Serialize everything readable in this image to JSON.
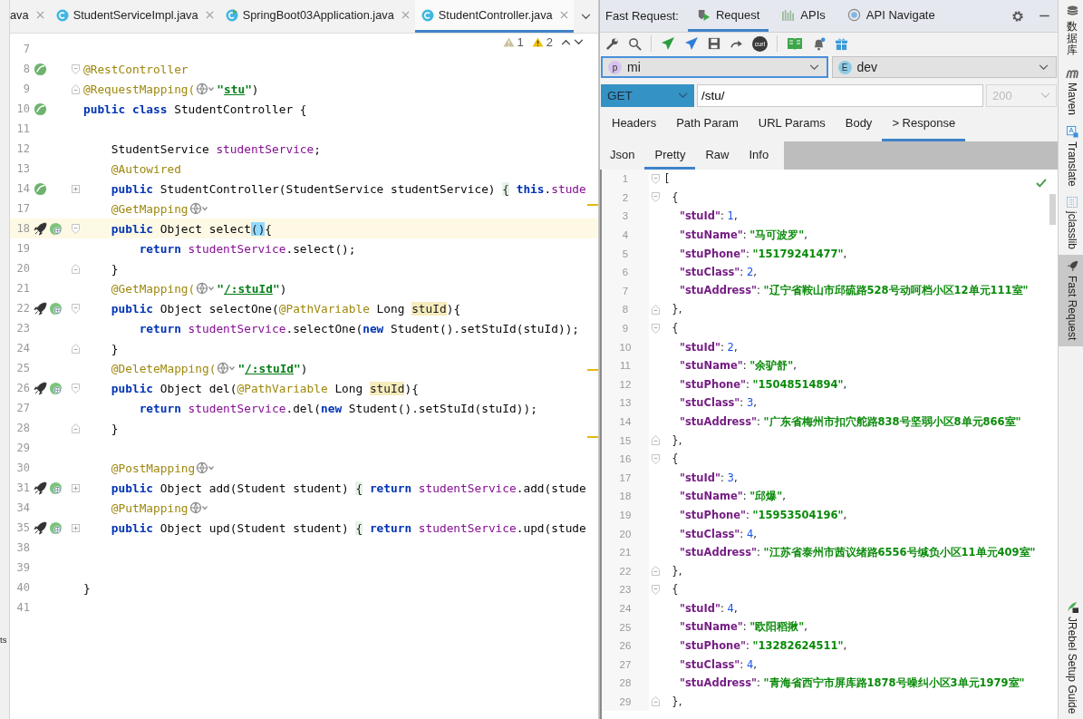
{
  "editor": {
    "tabs": [
      {
        "label": "ava",
        "selected": false,
        "kind": "plain"
      },
      {
        "label": "StudentServiceImpl.java",
        "selected": false,
        "kind": "class"
      },
      {
        "label": "SpringBoot03Application.java",
        "selected": false,
        "kind": "app"
      },
      {
        "label": "StudentController.java",
        "selected": true,
        "kind": "class"
      }
    ],
    "inspection": {
      "weak_warnings": "1",
      "warnings": "2"
    },
    "lines": [
      {
        "num": "7"
      },
      {
        "num": "8",
        "gutter": [
          {
            "kind": "bean"
          }
        ],
        "fold": {
          "kind": "open"
        },
        "tokens": [
          {
            "text": "@RestController",
            "kind": "ann"
          }
        ]
      },
      {
        "num": "9",
        "fold": {
          "kind": "close"
        },
        "tokens": [
          {
            "text": "@RequestMapping(",
            "kind": "ann"
          },
          {
            "kind": "globe"
          },
          {
            "text": "\"",
            "kind": "str"
          },
          {
            "text": "stu",
            "kind": "url"
          },
          {
            "text": "\"",
            "kind": "str"
          },
          {
            "text": ")",
            "kind": "plain"
          }
        ]
      },
      {
        "num": "10",
        "gutter": [
          {
            "kind": "bean"
          }
        ],
        "tokens": [
          {
            "text": "public class ",
            "kind": "kw"
          },
          {
            "text": "StudentController {",
            "kind": "plain"
          }
        ]
      },
      {
        "num": "11"
      },
      {
        "num": "12",
        "tokens": [
          {
            "text": "    StudentService ",
            "kind": "plain"
          },
          {
            "text": "studentService",
            "kind": "field"
          },
          {
            "text": ";",
            "kind": "plain"
          }
        ]
      },
      {
        "num": "13",
        "tokens": [
          {
            "text": "    @Autowired",
            "kind": "ann"
          }
        ]
      },
      {
        "num": "14",
        "gutter": [
          {
            "kind": "bean"
          }
        ],
        "fold": {
          "kind": "plus"
        },
        "tokens": [
          {
            "text": "    public ",
            "kind": "kw"
          },
          {
            "text": "StudentController(StudentService studentService) ",
            "kind": "plain"
          },
          {
            "text": "{",
            "kind": "fold"
          },
          {
            "text": " this",
            "kind": "kw"
          },
          {
            "text": ".",
            "kind": "plain"
          },
          {
            "text": "stude",
            "kind": "field"
          }
        ]
      },
      {
        "num": "17",
        "tokens": [
          {
            "text": "    @GetMapping",
            "kind": "ann"
          },
          {
            "kind": "globe"
          }
        ]
      },
      {
        "num": "18",
        "highlighted": true,
        "gutter": [
          {
            "kind": "rocket"
          },
          {
            "kind": "globe"
          }
        ],
        "fold": {
          "kind": "open"
        },
        "tokens": [
          {
            "text": "    public ",
            "kind": "kw"
          },
          {
            "text": "Object select",
            "kind": "plain"
          },
          {
            "text": "()",
            "kind": "match"
          },
          {
            "text": "{",
            "kind": "plain"
          }
        ]
      },
      {
        "num": "19",
        "tokens": [
          {
            "text": "        return ",
            "kind": "kw"
          },
          {
            "text": "studentService",
            "kind": "field"
          },
          {
            "text": ".select();",
            "kind": "plain"
          }
        ]
      },
      {
        "num": "20",
        "fold": {
          "kind": "close"
        },
        "tokens": [
          {
            "text": "    }",
            "kind": "plain"
          }
        ]
      },
      {
        "num": "21",
        "tokens": [
          {
            "text": "    @GetMapping(",
            "kind": "ann"
          },
          {
            "kind": "globe"
          },
          {
            "text": "\"",
            "kind": "str"
          },
          {
            "text": "/:stuId",
            "kind": "url"
          },
          {
            "text": "\"",
            "kind": "str"
          },
          {
            "text": ")",
            "kind": "plain"
          }
        ]
      },
      {
        "num": "22",
        "gutter": [
          {
            "kind": "rocket"
          },
          {
            "kind": "globe"
          }
        ],
        "fold": {
          "kind": "open"
        },
        "tokens": [
          {
            "text": "    public ",
            "kind": "kw"
          },
          {
            "text": "Object selectOne(",
            "kind": "plain"
          },
          {
            "text": "@PathVariable",
            "kind": "ann"
          },
          {
            "text": " Long ",
            "kind": "plain"
          },
          {
            "text": "stuId",
            "kind": "hl"
          },
          {
            "text": "){",
            "kind": "plain"
          }
        ]
      },
      {
        "num": "23",
        "tokens": [
          {
            "text": "        return ",
            "kind": "kw"
          },
          {
            "text": "studentService",
            "kind": "field"
          },
          {
            "text": ".selectOne(",
            "kind": "plain"
          },
          {
            "text": "new",
            "kind": "kw"
          },
          {
            "text": " Student().setStuId(stuId));",
            "kind": "plain"
          }
        ]
      },
      {
        "num": "24",
        "fold": {
          "kind": "close"
        },
        "tokens": [
          {
            "text": "    }",
            "kind": "plain"
          }
        ]
      },
      {
        "num": "25",
        "tokens": [
          {
            "text": "    @DeleteMapping(",
            "kind": "ann"
          },
          {
            "kind": "globe"
          },
          {
            "text": "\"",
            "kind": "str"
          },
          {
            "text": "/:stuId",
            "kind": "url"
          },
          {
            "text": "\"",
            "kind": "str"
          },
          {
            "text": ")",
            "kind": "plain"
          }
        ]
      },
      {
        "num": "26",
        "gutter": [
          {
            "kind": "rocket"
          },
          {
            "kind": "globe"
          }
        ],
        "fold": {
          "kind": "open"
        },
        "tokens": [
          {
            "text": "    public ",
            "kind": "kw"
          },
          {
            "text": "Object del(",
            "kind": "plain"
          },
          {
            "text": "@PathVariable",
            "kind": "ann"
          },
          {
            "text": " Long ",
            "kind": "plain"
          },
          {
            "text": "stuId",
            "kind": "hl"
          },
          {
            "text": "){",
            "kind": "plain"
          }
        ]
      },
      {
        "num": "27",
        "tokens": [
          {
            "text": "        return ",
            "kind": "kw"
          },
          {
            "text": "studentService",
            "kind": "field"
          },
          {
            "text": ".del(",
            "kind": "plain"
          },
          {
            "text": "new",
            "kind": "kw"
          },
          {
            "text": " Student().setStuId(stuId));",
            "kind": "plain"
          }
        ]
      },
      {
        "num": "28",
        "fold": {
          "kind": "close"
        },
        "tokens": [
          {
            "text": "    }",
            "kind": "plain"
          }
        ]
      },
      {
        "num": "29"
      },
      {
        "num": "30",
        "tokens": [
          {
            "text": "    @PostMapping",
            "kind": "ann"
          },
          {
            "kind": "globe"
          }
        ]
      },
      {
        "num": "31",
        "gutter": [
          {
            "kind": "rocket"
          },
          {
            "kind": "globe"
          }
        ],
        "fold": {
          "kind": "plus"
        },
        "tokens": [
          {
            "text": "    public ",
            "kind": "kw"
          },
          {
            "text": "Object add(Student student) ",
            "kind": "plain"
          },
          {
            "text": "{",
            "kind": "fold"
          },
          {
            "text": " return ",
            "kind": "kw"
          },
          {
            "text": "studentService",
            "kind": "field"
          },
          {
            "text": ".add(stude",
            "kind": "plain"
          }
        ]
      },
      {
        "num": "34",
        "tokens": [
          {
            "text": "    @PutMapping",
            "kind": "ann"
          },
          {
            "kind": "globe"
          }
        ]
      },
      {
        "num": "35",
        "gutter": [
          {
            "kind": "rocket"
          },
          {
            "kind": "globe"
          }
        ],
        "fold": {
          "kind": "plus"
        },
        "tokens": [
          {
            "text": "    public ",
            "kind": "kw"
          },
          {
            "text": "Object upd(Student student) ",
            "kind": "plain"
          },
          {
            "text": "{",
            "kind": "fold"
          },
          {
            "text": " return ",
            "kind": "kw"
          },
          {
            "text": "studentService",
            "kind": "field"
          },
          {
            "text": ".upd(stude",
            "kind": "plain"
          }
        ]
      },
      {
        "num": "38"
      },
      {
        "num": "39"
      },
      {
        "num": "40",
        "tokens": [
          {
            "text": "}",
            "kind": "plain"
          }
        ]
      },
      {
        "num": "41"
      }
    ],
    "left_strip": {
      "text": "ts"
    }
  },
  "fast_request": {
    "title": "Fast Request:",
    "tabs": [
      {
        "label": "Request",
        "selected": true,
        "kind": "request"
      },
      {
        "label": "APIs",
        "selected": false,
        "kind": "apis"
      },
      {
        "label": "API Navigate",
        "selected": false,
        "kind": "navigate"
      }
    ],
    "curl_label": "curl",
    "project": {
      "badge": "p",
      "value": "mi",
      "focused": true
    },
    "environment": {
      "badge": "E",
      "value": "dev",
      "focused": false
    },
    "method": "GET",
    "url": "/stu/",
    "status": {
      "value": "200",
      "disabled": true
    },
    "request_tabs": [
      {
        "label": "Headers",
        "selected": false
      },
      {
        "label": "Path Param",
        "selected": false
      },
      {
        "label": "URL Params",
        "selected": false
      },
      {
        "label": "Body",
        "selected": false
      },
      {
        "label": "> Response",
        "selected": true
      }
    ],
    "response_tabs": [
      {
        "label": "Json",
        "selected": false
      },
      {
        "label": "Pretty",
        "selected": true
      },
      {
        "label": "Raw",
        "selected": false
      },
      {
        "label": "Info",
        "selected": false
      }
    ],
    "response_lines": [
      {
        "num": "1",
        "fold": {
          "kind": "open"
        },
        "tokens": [
          {
            "text": "[",
            "kind": "punct"
          }
        ]
      },
      {
        "num": "2",
        "fold": {
          "kind": "open"
        },
        "tokens": [
          {
            "text": "  {",
            "kind": "punct"
          }
        ]
      },
      {
        "num": "3",
        "tokens": [
          {
            "text": "    \"stuId\"",
            "kind": "key"
          },
          {
            "text": ": ",
            "kind": "punct"
          },
          {
            "text": "1",
            "kind": "num"
          },
          {
            "text": ",",
            "kind": "punct"
          }
        ]
      },
      {
        "num": "4",
        "tokens": [
          {
            "text": "    \"stuName\"",
            "kind": "key"
          },
          {
            "text": ": ",
            "kind": "punct"
          },
          {
            "text": "\"马可波罗\"",
            "kind": "str"
          },
          {
            "text": ",",
            "kind": "punct"
          }
        ]
      },
      {
        "num": "5",
        "tokens": [
          {
            "text": "    \"stuPhone\"",
            "kind": "key"
          },
          {
            "text": ": ",
            "kind": "punct"
          },
          {
            "text": "\"15179241477\"",
            "kind": "str"
          },
          {
            "text": ",",
            "kind": "punct"
          }
        ]
      },
      {
        "num": "6",
        "tokens": [
          {
            "text": "    \"stuClass\"",
            "kind": "key"
          },
          {
            "text": ": ",
            "kind": "punct"
          },
          {
            "text": "2",
            "kind": "num"
          },
          {
            "text": ",",
            "kind": "punct"
          }
        ]
      },
      {
        "num": "7",
        "tokens": [
          {
            "text": "    \"stuAddress\"",
            "kind": "key"
          },
          {
            "text": ": ",
            "kind": "punct"
          },
          {
            "text": "\"辽宁省鞍山市邱硫路528号动呵档小区12单元111室\"",
            "kind": "str"
          }
        ]
      },
      {
        "num": "8",
        "fold": {
          "kind": "close"
        },
        "tokens": [
          {
            "text": "  },",
            "kind": "punct"
          }
        ]
      },
      {
        "num": "9",
        "fold": {
          "kind": "open"
        },
        "tokens": [
          {
            "text": "  {",
            "kind": "punct"
          }
        ]
      },
      {
        "num": "10",
        "tokens": [
          {
            "text": "    \"stuId\"",
            "kind": "key"
          },
          {
            "text": ": ",
            "kind": "punct"
          },
          {
            "text": "2",
            "kind": "num"
          },
          {
            "text": ",",
            "kind": "punct"
          }
        ]
      },
      {
        "num": "11",
        "tokens": [
          {
            "text": "    \"stuName\"",
            "kind": "key"
          },
          {
            "text": ": ",
            "kind": "punct"
          },
          {
            "text": "\"余驴舒\"",
            "kind": "str"
          },
          {
            "text": ",",
            "kind": "punct"
          }
        ]
      },
      {
        "num": "12",
        "tokens": [
          {
            "text": "    \"stuPhone\"",
            "kind": "key"
          },
          {
            "text": ": ",
            "kind": "punct"
          },
          {
            "text": "\"15048514894\"",
            "kind": "str"
          },
          {
            "text": ",",
            "kind": "punct"
          }
        ]
      },
      {
        "num": "13",
        "tokens": [
          {
            "text": "    \"stuClass\"",
            "kind": "key"
          },
          {
            "text": ": ",
            "kind": "punct"
          },
          {
            "text": "3",
            "kind": "num"
          },
          {
            "text": ",",
            "kind": "punct"
          }
        ]
      },
      {
        "num": "14",
        "tokens": [
          {
            "text": "    \"stuAddress\"",
            "kind": "key"
          },
          {
            "text": ": ",
            "kind": "punct"
          },
          {
            "text": "\"广东省梅州市扣穴舵路838号坚弱小区8单元866室\"",
            "kind": "str"
          }
        ]
      },
      {
        "num": "15",
        "fold": {
          "kind": "close"
        },
        "tokens": [
          {
            "text": "  },",
            "kind": "punct"
          }
        ]
      },
      {
        "num": "16",
        "fold": {
          "kind": "open"
        },
        "tokens": [
          {
            "text": "  {",
            "kind": "punct"
          }
        ]
      },
      {
        "num": "17",
        "tokens": [
          {
            "text": "    \"stuId\"",
            "kind": "key"
          },
          {
            "text": ": ",
            "kind": "punct"
          },
          {
            "text": "3",
            "kind": "num"
          },
          {
            "text": ",",
            "kind": "punct"
          }
        ]
      },
      {
        "num": "18",
        "tokens": [
          {
            "text": "    \"stuName\"",
            "kind": "key"
          },
          {
            "text": ": ",
            "kind": "punct"
          },
          {
            "text": "\"邱爆\"",
            "kind": "str"
          },
          {
            "text": ",",
            "kind": "punct"
          }
        ]
      },
      {
        "num": "19",
        "tokens": [
          {
            "text": "    \"stuPhone\"",
            "kind": "key"
          },
          {
            "text": ": ",
            "kind": "punct"
          },
          {
            "text": "\"15953504196\"",
            "kind": "str"
          },
          {
            "text": ",",
            "kind": "punct"
          }
        ]
      },
      {
        "num": "20",
        "tokens": [
          {
            "text": "    \"stuClass\"",
            "kind": "key"
          },
          {
            "text": ": ",
            "kind": "punct"
          },
          {
            "text": "4",
            "kind": "num"
          },
          {
            "text": ",",
            "kind": "punct"
          }
        ]
      },
      {
        "num": "21",
        "tokens": [
          {
            "text": "    \"stuAddress\"",
            "kind": "key"
          },
          {
            "text": ": ",
            "kind": "punct"
          },
          {
            "text": "\"江苏省泰州市茜议绪路6556号缄负小区11单元409室\"",
            "kind": "str"
          }
        ]
      },
      {
        "num": "22",
        "fold": {
          "kind": "close"
        },
        "tokens": [
          {
            "text": "  },",
            "kind": "punct"
          }
        ]
      },
      {
        "num": "23",
        "fold": {
          "kind": "open"
        },
        "tokens": [
          {
            "text": "  {",
            "kind": "punct"
          }
        ]
      },
      {
        "num": "24",
        "tokens": [
          {
            "text": "    \"stuId\"",
            "kind": "key"
          },
          {
            "text": ": ",
            "kind": "punct"
          },
          {
            "text": "4",
            "kind": "num"
          },
          {
            "text": ",",
            "kind": "punct"
          }
        ]
      },
      {
        "num": "25",
        "tokens": [
          {
            "text": "    \"stuName\"",
            "kind": "key"
          },
          {
            "text": ": ",
            "kind": "punct"
          },
          {
            "text": "\"欧阳稻揪\"",
            "kind": "str"
          },
          {
            "text": ",",
            "kind": "punct"
          }
        ]
      },
      {
        "num": "26",
        "tokens": [
          {
            "text": "    \"stuPhone\"",
            "kind": "key"
          },
          {
            "text": ": ",
            "kind": "punct"
          },
          {
            "text": "\"13282624511\"",
            "kind": "str"
          },
          {
            "text": ",",
            "kind": "punct"
          }
        ]
      },
      {
        "num": "27",
        "tokens": [
          {
            "text": "    \"stuClass\"",
            "kind": "key"
          },
          {
            "text": ": ",
            "kind": "punct"
          },
          {
            "text": "4",
            "kind": "num"
          },
          {
            "text": ",",
            "kind": "punct"
          }
        ]
      },
      {
        "num": "28",
        "tokens": [
          {
            "text": "    \"stuAddress\"",
            "kind": "key"
          },
          {
            "text": ": ",
            "kind": "punct"
          },
          {
            "text": "\"青海省西宁市屏库路1878号噪纠小区3单元1979室\"",
            "kind": "str"
          }
        ]
      },
      {
        "num": "29",
        "fold": {
          "kind": "close"
        },
        "tokens": [
          {
            "text": "  },",
            "kind": "punct"
          }
        ]
      }
    ]
  },
  "tool_windows": {
    "top": [
      {
        "label": "数据库",
        "kind": "database",
        "stacked": true,
        "selected": false
      },
      {
        "label": "Maven",
        "kind": "maven",
        "stacked": false,
        "selected": false
      },
      {
        "label": "Translate",
        "kind": "translate",
        "stacked": false,
        "selected": false
      },
      {
        "label": "jclasslib",
        "kind": "jclasslib",
        "stacked": false,
        "selected": false
      },
      {
        "label": "Fast Request",
        "kind": "rocket",
        "stacked": false,
        "selected": true
      }
    ],
    "bottom": [
      {
        "label": "JRebel Setup Guide",
        "kind": "jrebel",
        "stacked": false,
        "selected": false
      }
    ]
  }
}
